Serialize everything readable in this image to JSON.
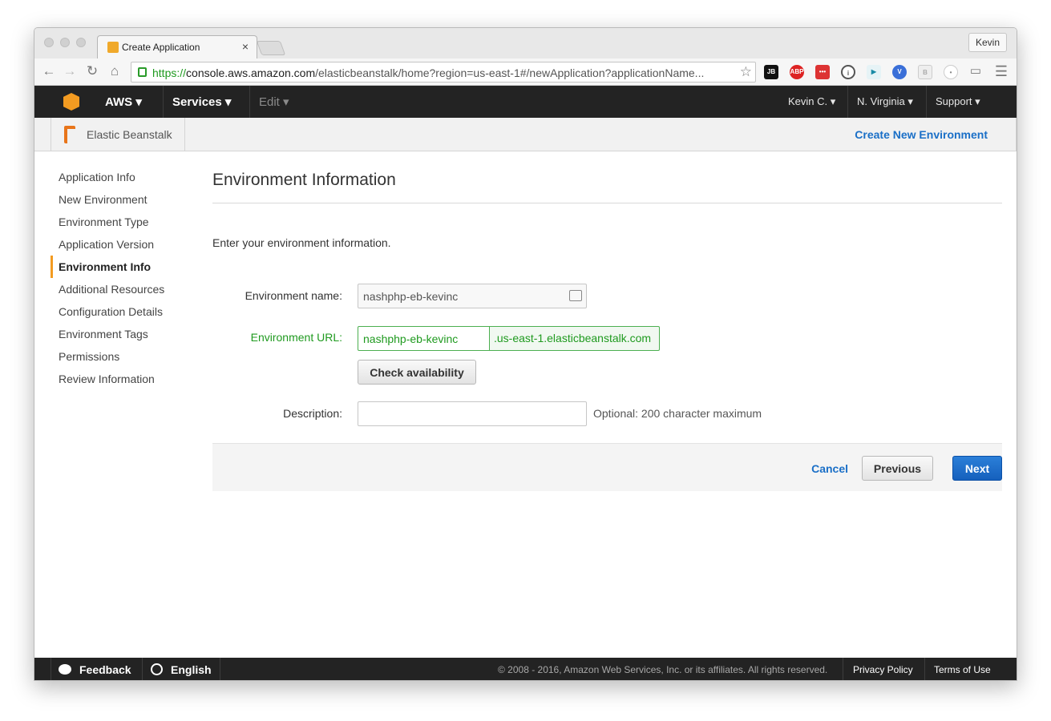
{
  "browser": {
    "tab_title": "Create Application",
    "tab_close": "×",
    "profile": "Kevin",
    "url_scheme": "https://",
    "url_host": "console.aws.amazon.com",
    "url_path": "/elasticbeanstalk/home?region=us-east-1#/newApplication?applicationName...",
    "extensions": [
      "JB",
      "ABP",
      "•••",
      "i",
      "▶",
      "V",
      "B",
      "•"
    ]
  },
  "aws_nav": {
    "brand": "AWS",
    "services": "Services",
    "edit": "Edit",
    "user": "Kevin C.",
    "region": "N. Virginia",
    "support": "Support"
  },
  "service_bar": {
    "service_name": "Elastic Beanstalk",
    "create_new_environment": "Create New Environment"
  },
  "sidebar": {
    "items": [
      {
        "label": "Application Info"
      },
      {
        "label": "New Environment"
      },
      {
        "label": "Environment Type"
      },
      {
        "label": "Application Version"
      },
      {
        "label": "Environment Info"
      },
      {
        "label": "Additional Resources"
      },
      {
        "label": "Configuration Details"
      },
      {
        "label": "Environment Tags"
      },
      {
        "label": "Permissions"
      },
      {
        "label": "Review Information"
      }
    ]
  },
  "main": {
    "title": "Environment Information",
    "intro": "Enter your environment information.",
    "env_name_label": "Environment name:",
    "env_name_value": "nashphp-eb-kevinc",
    "env_url_label": "Environment URL:",
    "env_url_value": "nashphp-eb-kevinc",
    "env_url_suffix": ".us-east-1.elasticbeanstalk.com",
    "check_availability": "Check availability",
    "description_label": "Description:",
    "description_value": "",
    "description_hint": "Optional: 200 character maximum",
    "cancel": "Cancel",
    "previous": "Previous",
    "next": "Next"
  },
  "footer": {
    "feedback": "Feedback",
    "language": "English",
    "copyright": "© 2008 - 2016, Amazon Web Services, Inc. or its affiliates. All rights reserved.",
    "privacy": "Privacy Policy",
    "terms": "Terms of Use"
  },
  "colors": {
    "accent": "#f39b21",
    "link": "#1a6fc7",
    "valid": "#1f9a1f",
    "nav_bg": "#232323"
  }
}
